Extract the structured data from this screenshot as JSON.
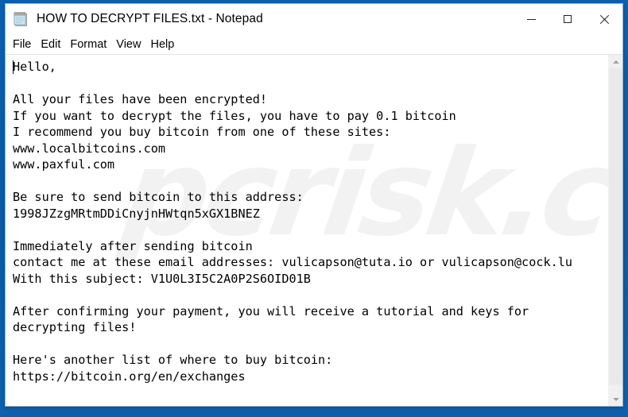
{
  "window": {
    "title": "HOW TO DECRYPT FILES.txt - Notepad",
    "icon": "notepad-icon",
    "controls": {
      "minimize": "–",
      "maximize": "□",
      "close": "✕"
    }
  },
  "menu": {
    "items": [
      {
        "label": "File"
      },
      {
        "label": "Edit"
      },
      {
        "label": "Format"
      },
      {
        "label": "View"
      },
      {
        "label": "Help"
      }
    ]
  },
  "document": {
    "lines": [
      "Hello,",
      "",
      "All your files have been encrypted!",
      "If you want to decrypt the files, you have to pay 0.1 bitcoin",
      "I recommend you buy bitcoin from one of these sites:",
      "www.localbitcoins.com",
      "www.paxful.com",
      "",
      "Be sure to send bitcoin to this address:",
      "1998JZzgMRtmDDiCnyjnHWtqn5xGX1BNEZ",
      "",
      "Immediately after sending bitcoin",
      "contact me at these email addresses: vulicapson@tuta.io or vulicapson@cock.lu",
      "With this subject: V1U0L3I5C2A0P2S6OID01B",
      "",
      "After confirming your payment, you will receive a tutorial and keys for",
      "decrypting files!",
      "",
      "Here's another list of where to buy bitcoin:",
      "https://bitcoin.org/en/exchanges"
    ],
    "ransom_details": {
      "ransom_amount": "0.1 bitcoin",
      "bitcoin_address": "1998JZzgMRtmDDiCnyjnHWtqn5xGX1BNEZ",
      "email_1": "vulicapson@tuta.io",
      "email_2": "vulicapson@cock.lu",
      "email_subject": "V1U0L3I5C2A0P2S6OID01B",
      "exchange_sites": [
        "www.localbitcoins.com",
        "www.paxful.com",
        "https://bitcoin.org/en/exchanges"
      ]
    }
  },
  "watermark": {
    "text": "pcrisk.com"
  },
  "scrollbar": {
    "up_arrow": "scroll-up-icon",
    "down_arrow": "scroll-down-icon"
  },
  "colors": {
    "desktop": "#0a59a5",
    "window_bg": "#ffffff",
    "text": "#000000",
    "scrollbar_track": "#f0f0f0",
    "scrollbar_thumb": "#e9e9e9",
    "watermark": "#f2f2f2"
  }
}
